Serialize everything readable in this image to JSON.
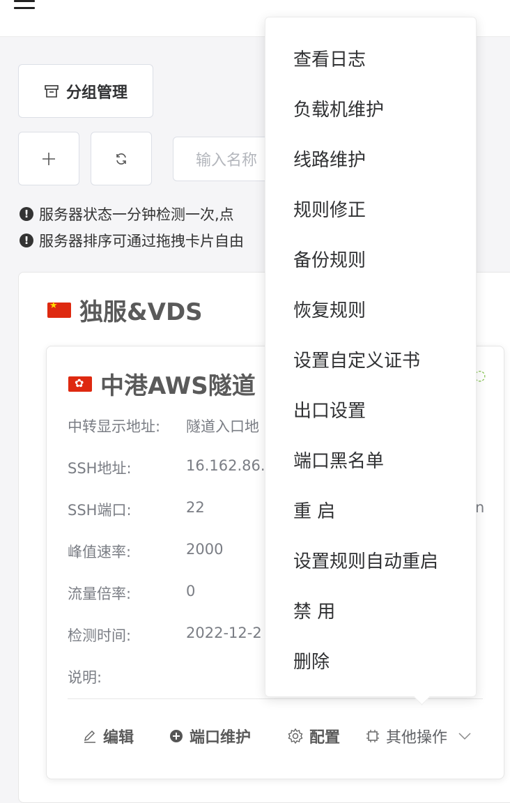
{
  "topbar": {
    "menu_icon": "hamburger-menu-icon"
  },
  "toolbar": {
    "group_manage_label": "分组管理",
    "group_manage_icon": "archive-box-icon",
    "add_icon": "plus-icon",
    "refresh_icon": "refresh-icon",
    "search_placeholder": "输入名称"
  },
  "notices": [
    {
      "text": "服务器状态一分钟检测一次,点"
    },
    {
      "text": "服务器排序可通过拖拽卡片自由"
    }
  ],
  "group": {
    "title": "独服&VDS",
    "flag": "china-flag-icon"
  },
  "server": {
    "title": "中港AWS隧道",
    "flag": "hong-kong-flag-icon",
    "fields": [
      {
        "label": "中转显示地址:",
        "value": "隧道入口地"
      },
      {
        "label": "SSH地址:",
        "value": "16.162.86."
      },
      {
        "label": "SSH端口:",
        "value": "22"
      },
      {
        "label": "峰值速率:",
        "value": "2000"
      },
      {
        "label": "流量倍率:",
        "value": "0"
      },
      {
        "label": "检测时间:",
        "value": "2022-12-2"
      },
      {
        "label": "说明:",
        "value": ""
      }
    ],
    "trailing_char": "n"
  },
  "actions": {
    "edit": "编辑",
    "port_maintenance": "端口维护",
    "config": "配置",
    "other": "其他操作"
  },
  "dropdown": {
    "items": [
      "查看日志",
      "负载机维护",
      "线路维护",
      "规则修正",
      "备份规则",
      "恢复规则",
      "设置自定义证书",
      "出口设置",
      "端口黑名单",
      "重 启",
      "设置规则自动重启",
      "禁 用",
      "删除"
    ]
  },
  "colors": {
    "accent_green": "#7bc043",
    "text": "#303133",
    "muted": "#7a7d84"
  }
}
